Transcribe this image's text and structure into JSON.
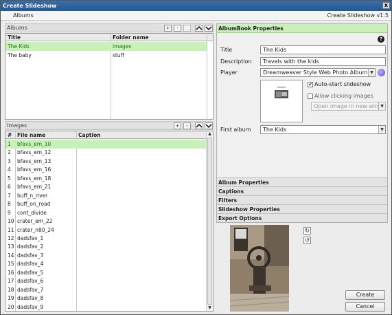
{
  "window": {
    "title": "Create Slideshow",
    "close_label": "x"
  },
  "menubar": {
    "albums_label": "Albums",
    "version": "Create Slideshow v1.5"
  },
  "albums": {
    "title": "Albums",
    "add_label": "+",
    "remove_label": "-",
    "extra_label": "...",
    "columns": {
      "title": "Title",
      "folder": "Folder name"
    },
    "rows": [
      {
        "title": "The Kids",
        "folder": "images",
        "selected": true
      },
      {
        "title": "The baby",
        "folder": "stuff",
        "selected": false
      }
    ]
  },
  "images": {
    "title": "Images",
    "add_label": "+",
    "remove_label": "-",
    "columns": {
      "num": "#",
      "file": "File name",
      "caption": "Caption"
    },
    "rows": [
      {
        "num": "1",
        "file": "bfavs_em_10",
        "caption": "",
        "selected": true
      },
      {
        "num": "2",
        "file": "bfavs_em_12",
        "caption": ""
      },
      {
        "num": "3",
        "file": "bfavs_em_13",
        "caption": ""
      },
      {
        "num": "4",
        "file": "bfavs_em_16",
        "caption": ""
      },
      {
        "num": "5",
        "file": "bfavs_em_18",
        "caption": ""
      },
      {
        "num": "6",
        "file": "bfavs_em_21",
        "caption": ""
      },
      {
        "num": "7",
        "file": "buff_n_river",
        "caption": ""
      },
      {
        "num": "8",
        "file": "buff_on_road",
        "caption": ""
      },
      {
        "num": "9",
        "file": "cont_divide",
        "caption": ""
      },
      {
        "num": "10",
        "file": "crater_em_22",
        "caption": ""
      },
      {
        "num": "11",
        "file": "crater_n80_24",
        "caption": ""
      },
      {
        "num": "12",
        "file": "dadsfav_1",
        "caption": ""
      },
      {
        "num": "13",
        "file": "dadsfav_2",
        "caption": ""
      },
      {
        "num": "14",
        "file": "dadsfav_3",
        "caption": ""
      },
      {
        "num": "15",
        "file": "dadsfav_4",
        "caption": ""
      },
      {
        "num": "16",
        "file": "dadsfav_5",
        "caption": ""
      },
      {
        "num": "17",
        "file": "dadsfav_6",
        "caption": ""
      },
      {
        "num": "18",
        "file": "dadsfav_7",
        "caption": ""
      },
      {
        "num": "19",
        "file": "dadsfav_8",
        "caption": ""
      },
      {
        "num": "20",
        "file": "dadsfav_9",
        "caption": ""
      }
    ]
  },
  "properties": {
    "header": "AlbumBook Properties",
    "title_label": "Title",
    "title_value": "The Kids",
    "description_label": "Description",
    "description_value": "Travels with the kids",
    "player_label": "Player",
    "player_value": "Dreamweaver Style Web Photo Album (Flash)",
    "autostart_label": "Auto-start slideshow",
    "autostart_checked": true,
    "allow_click_label": "Allow clicking images",
    "allow_click_checked": false,
    "open_mode_value": "Open image in new window",
    "first_album_label": "First album",
    "first_album_value": "The Kids"
  },
  "accordion": [
    "Album Properties",
    "Captions",
    "Filters",
    "Slideshow Properties",
    "Export Options"
  ],
  "actions": {
    "create": "Create",
    "cancel": "Cancel"
  },
  "icons": {
    "close": "close-icon",
    "help": "help-icon",
    "rotate_cw": "rotate-clockwise-icon",
    "rotate_ccw": "rotate-counterclockwise-icon"
  },
  "colors": {
    "selection": "#c9f0b8",
    "selection_text": "#127a12",
    "titlebar": "#24588f"
  }
}
